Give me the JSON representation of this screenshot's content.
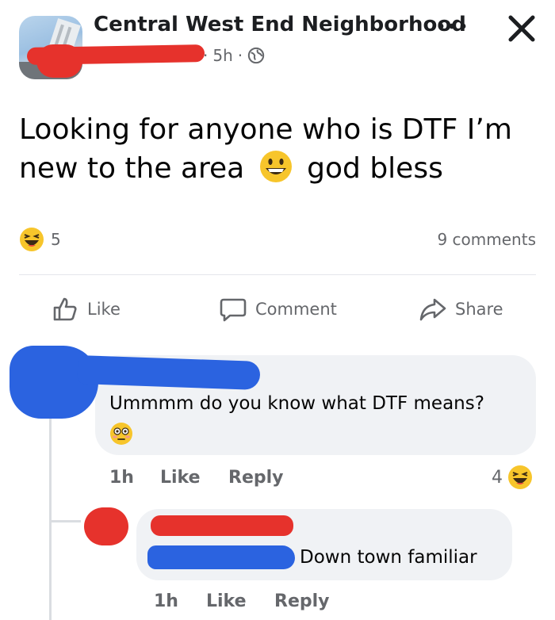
{
  "post": {
    "group_name": "Central West End Neighborhood",
    "time": "5h",
    "separator": "·",
    "text_part1": "Looking for anyone who is DTF I’m new to the area",
    "text_part2": "god bless",
    "reaction_count": "5",
    "comments_count": "9 comments"
  },
  "actions": {
    "like": "Like",
    "comment": "Comment",
    "share": "Share"
  },
  "comments": [
    {
      "text": "Ummmm do you know what DTF means?",
      "time": "1h",
      "like": "Like",
      "reply": "Reply",
      "reaction_count": "4"
    },
    {
      "text": "Down town familiar",
      "time": "1h",
      "like": "Like",
      "reply": "Reply"
    }
  ],
  "colors": {
    "text_primary": "#050505",
    "text_secondary": "#65676b",
    "bubble": "#f0f2f5",
    "redaction_blue": "#2b63e0",
    "redaction_red": "#e6322c",
    "emoji_yellow": "#f7c52b"
  },
  "icons": [
    "group-avatar",
    "globe-icon",
    "more-icon",
    "close-icon",
    "grinning-emoji",
    "laughing-emoji",
    "flushed-emoji",
    "like-icon",
    "comment-icon",
    "share-icon"
  ]
}
